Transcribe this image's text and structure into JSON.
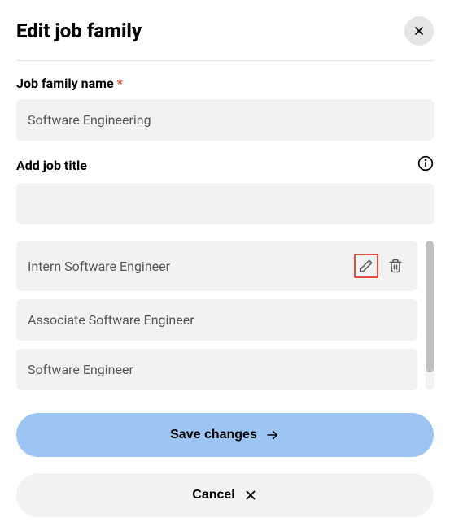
{
  "modal": {
    "title": "Edit job family"
  },
  "fields": {
    "family_name": {
      "label": "Job family name",
      "value": "Software Engineering"
    },
    "add_title": {
      "label": "Add job title",
      "value": ""
    }
  },
  "job_titles": [
    {
      "name": "Intern Software Engineer",
      "highlighted": true,
      "show_actions": true
    },
    {
      "name": "Associate Software Engineer",
      "highlighted": false,
      "show_actions": false
    },
    {
      "name": "Software Engineer",
      "highlighted": false,
      "show_actions": false
    }
  ],
  "buttons": {
    "save": "Save changes",
    "cancel": "Cancel"
  }
}
